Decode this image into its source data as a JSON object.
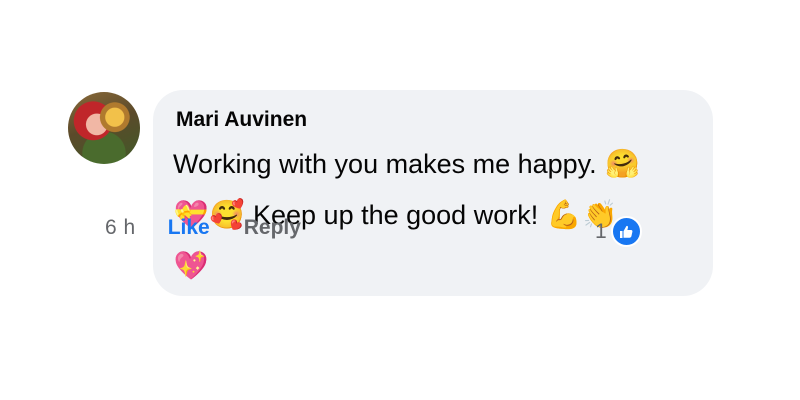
{
  "comment": {
    "author": "Mari Auvinen",
    "line1": "Working with you makes me happy.",
    "line2": "Keep up the good work!",
    "emojis": {
      "hug": "🤗",
      "heart_ribbon": "💝",
      "smiling_hearts": "🥰",
      "flexed_biceps": "💪",
      "clapping_hands": "👏",
      "sparkling_heart": "💖"
    }
  },
  "actions": {
    "time": "6 h",
    "like_label": "Like",
    "reply_label": "Reply"
  },
  "reactions": {
    "count": "1",
    "icon": "thumbs-up-icon",
    "color": "#1877f2"
  },
  "colors": {
    "bubble": "#f0f2f5",
    "text": "#050505",
    "secondary": "#65676b",
    "accent": "#1877f2"
  }
}
